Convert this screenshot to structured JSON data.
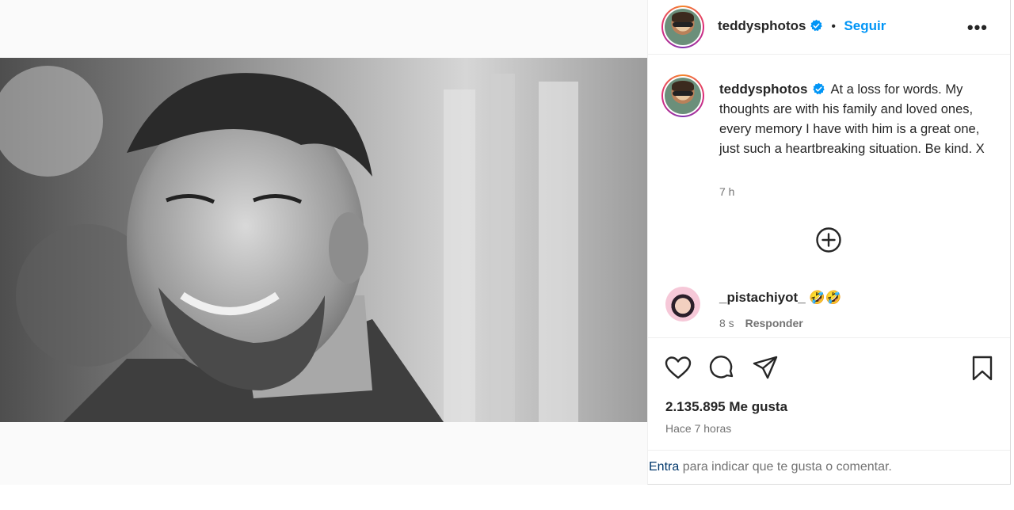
{
  "header": {
    "username": "teddysphotos",
    "separator": "•",
    "follow_label": "Seguir",
    "more_label": "•••"
  },
  "caption": {
    "username": "teddysphotos",
    "text": "At a loss for words. My thoughts are with his family and loved ones, every memory I have with him is a great one, just such a heartbreaking situation. Be kind. X",
    "time": "7 h"
  },
  "comment": {
    "username": "_pistachiyot_",
    "emoji": "🤣🤣",
    "time": "8 s",
    "reply_label": "Responder"
  },
  "stats": {
    "likes": "2.135.895 Me gusta",
    "ago": "Hace 7 horas"
  },
  "login_bar": {
    "link": "Entra",
    "text": " para indicar que te gusta o comentar."
  },
  "colors": {
    "accent": "#0095f6",
    "verified": "#0095f6",
    "muted": "#737373"
  },
  "icons": [
    "verified-badge-icon",
    "more-options-icon",
    "load-more-comments-icon",
    "heart-icon",
    "comment-icon",
    "share-icon",
    "bookmark-icon"
  ]
}
